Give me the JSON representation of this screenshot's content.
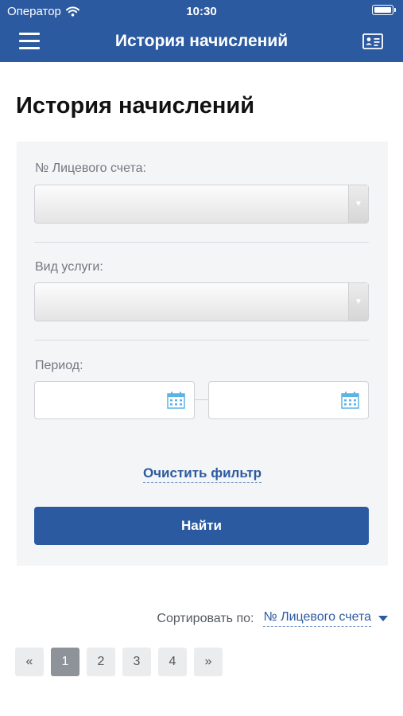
{
  "status_bar": {
    "carrier": "Оператор",
    "time": "10:30"
  },
  "nav": {
    "title": "История начислений",
    "menu_icon": "hamburger-menu-icon",
    "card_icon": "id-card-icon"
  },
  "page": {
    "title": "История начислений"
  },
  "filter": {
    "account_label": "№ Лицевого счета:",
    "account_value": "",
    "service_label": "Вид услуги:",
    "service_value": "",
    "period_label": "Период:",
    "period_from": "",
    "period_to": "",
    "clear_label": "Очистить фильтр",
    "find_label": "Найти"
  },
  "sort": {
    "label": "Сортировать по:",
    "value": "№ Лицевого счета"
  },
  "pagination": {
    "prev": "«",
    "pages": [
      "1",
      "2",
      "3",
      "4"
    ],
    "current": "1",
    "next": "»"
  },
  "colors": {
    "primary": "#2c5aa0",
    "panel_bg": "#f4f5f7",
    "calendar_icon": "#5bb3e6",
    "active_page": "#8e9299"
  }
}
